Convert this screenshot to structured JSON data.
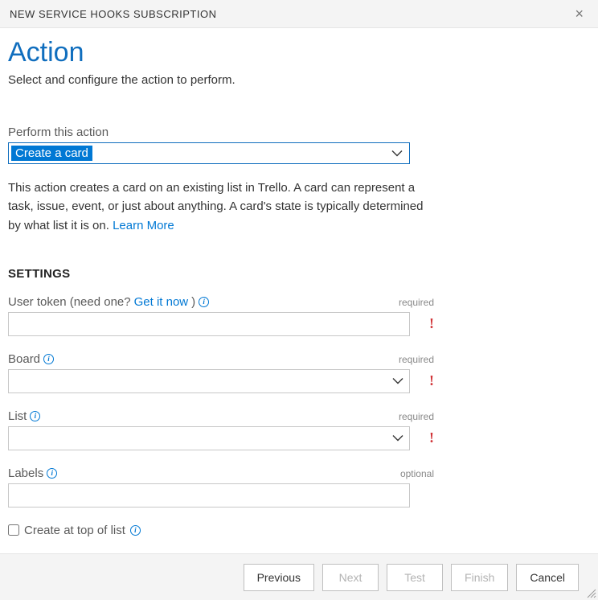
{
  "dialog": {
    "title": "NEW SERVICE HOOKS SUBSCRIPTION"
  },
  "heading": "Action",
  "subtitle": "Select and configure the action to perform.",
  "action_select": {
    "label": "Perform this action",
    "selected": "Create a card"
  },
  "description_text": "This action creates a card on an existing list in Trello. A card can represent a task, issue, event, or just about anything. A card's state is typically determined by what list it is on. ",
  "learn_more": "Learn More",
  "settings_heading": "SETTINGS",
  "fields": {
    "user_token": {
      "label_prefix": "User token (need one? ",
      "link": "Get it now",
      "label_suffix": ")",
      "req": "required"
    },
    "board": {
      "label": "Board",
      "req": "required"
    },
    "list": {
      "label": "List",
      "req": "required"
    },
    "labels": {
      "label": "Labels",
      "req": "optional"
    },
    "create_top": {
      "label": "Create at top of list"
    }
  },
  "buttons": {
    "previous": "Previous",
    "next": "Next",
    "test": "Test",
    "finish": "Finish",
    "cancel": "Cancel"
  }
}
